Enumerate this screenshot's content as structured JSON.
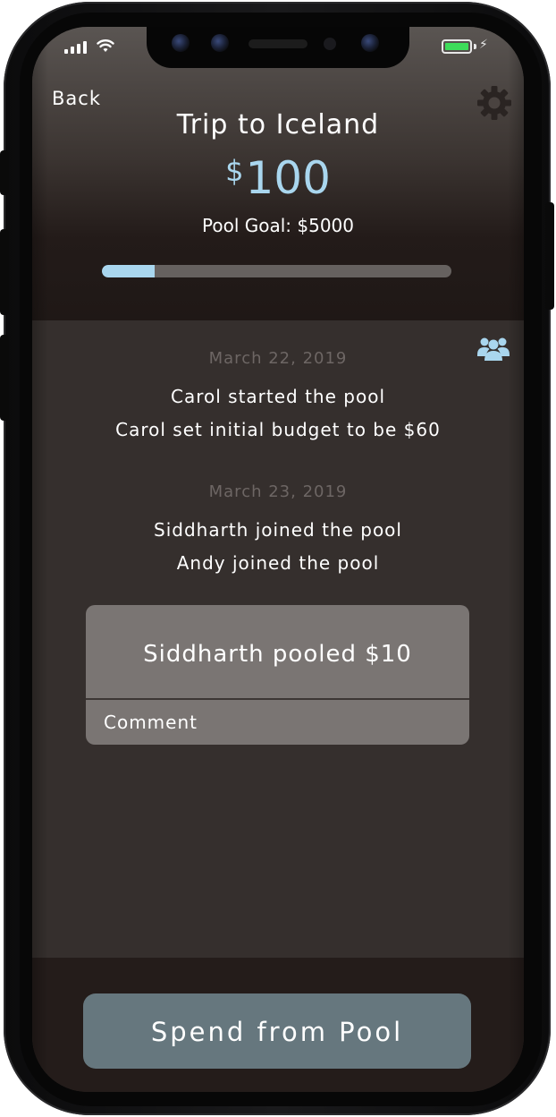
{
  "status_bar": {
    "signal_icon": "cellular-signal-icon",
    "wifi_icon": "wifi-icon",
    "battery_icon": "battery-charging-icon",
    "battery_level": 1.0,
    "battery_color": "#3ddc5a"
  },
  "header": {
    "back_label": "Back",
    "settings_icon": "gear-icon",
    "title": "Trip to Iceland",
    "currency_symbol": "$",
    "amount": "100",
    "goal_label": "Pool Goal: $5000",
    "progress": 0.15,
    "accent_color": "#a9d6ee"
  },
  "feed": {
    "members_icon": "people-group-icon",
    "groups": [
      {
        "date": "March 22, 2019",
        "events": [
          "Carol started the pool",
          "Carol set initial budget to be $60"
        ]
      },
      {
        "date": "March 23, 2019",
        "events": [
          "Siddharth joined the pool",
          "Andy joined the pool"
        ]
      }
    ],
    "card": {
      "text": "Siddharth pooled $10",
      "comment_placeholder": "Comment"
    }
  },
  "footer": {
    "spend_button_label": "Spend from Pool"
  }
}
